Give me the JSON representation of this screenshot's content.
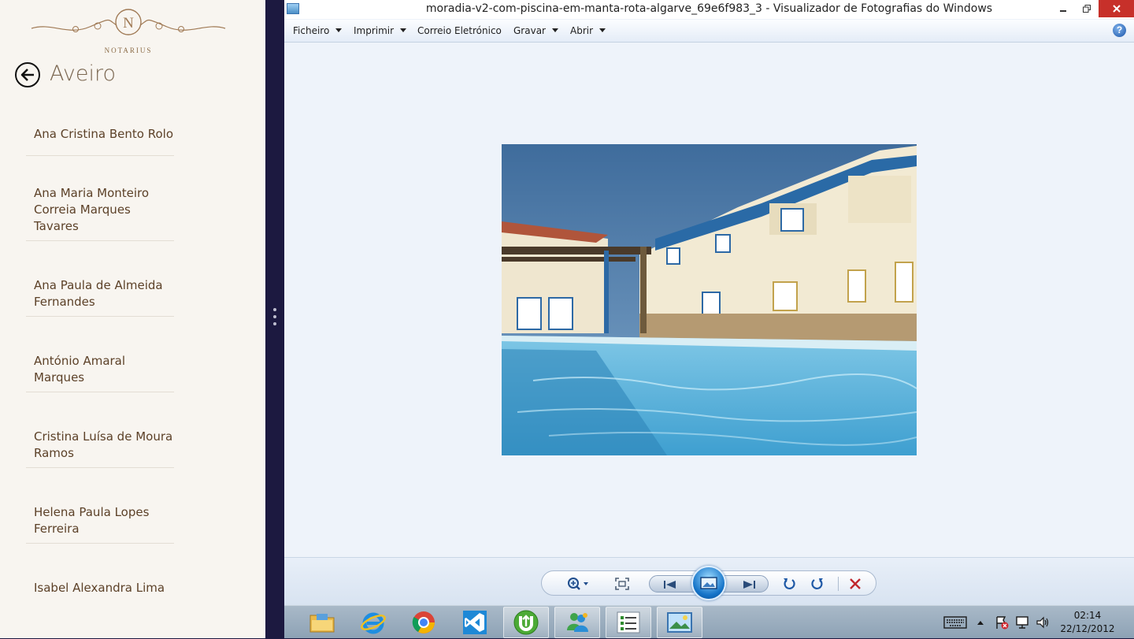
{
  "left_app": {
    "logo_text": "NOTARIUS",
    "logo_letter": "N",
    "title": "Aveiro",
    "notaries": [
      "Ana Cristina Bento Rolo",
      "Ana Maria Monteiro Correia Marques Tavares",
      "Ana Paula de Almeida Fernandes",
      "António Amaral Marques",
      "Cristina Luísa de Moura Ramos",
      "Helena Paula Lopes Ferreira",
      "Isabel Alexandra Lima"
    ]
  },
  "viewer": {
    "title": "moradia-v2-com-piscina-em-manta-rota-algarve_69e6f983_3 - Visualizador de Fotografias do Windows",
    "menu": {
      "file": "Ficheiro",
      "print": "Imprimir",
      "email": "Correio Eletrónico",
      "burn": "Gravar",
      "open": "Abrir"
    },
    "help_glyph": "?"
  },
  "colors": {
    "accent_close": "#c7302a",
    "left_bg": "#f8f5f0",
    "viewer_bg": "#eef3fa",
    "notary_text": "#5c4128"
  },
  "taskbar": {
    "apps": [
      "file-explorer-icon",
      "internet-explorer-icon",
      "chrome-icon",
      "visual-studio-icon",
      "utorrent-icon",
      "windows-live-messenger-icon",
      "task-list-icon",
      "photo-viewer-icon"
    ],
    "time": "02:14",
    "date": "22/12/2012"
  }
}
